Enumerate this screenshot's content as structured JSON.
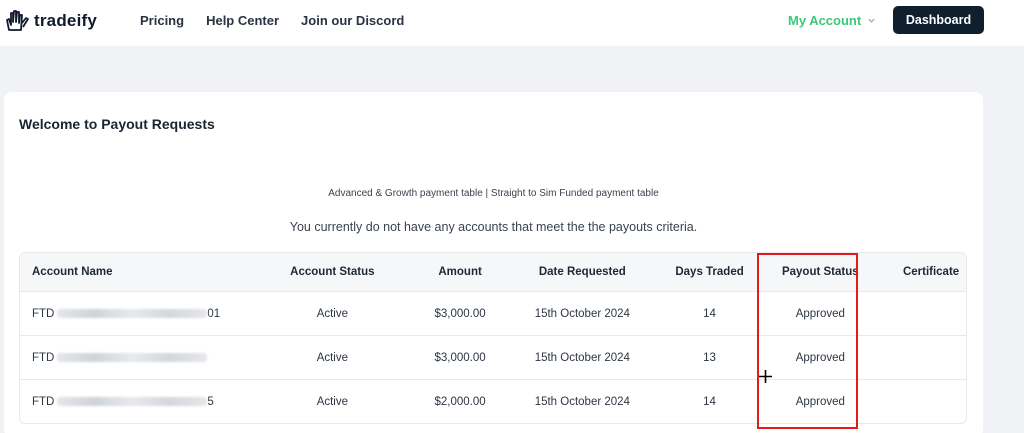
{
  "navbar": {
    "brand_name": "tradeify",
    "links": [
      "Pricing",
      "Help Center",
      "Join our Discord"
    ],
    "account_label": "My Account",
    "dashboard_label": "Dashboard"
  },
  "page": {
    "title": "Welcome to Payout Requests",
    "links_line": "Advanced & Growth payment table | Straight to Sim Funded payment table",
    "notice": "You currently do not have any accounts that meet the the payouts criteria."
  },
  "table": {
    "headers": [
      "Account Name",
      "Account Status",
      "Amount",
      "Date Requested",
      "Days Traded",
      "Payout Status",
      "Certificate"
    ],
    "rows": [
      {
        "account_prefix": "FTD",
        "account_suffix": "01",
        "status": "Active",
        "amount": "$3,000.00",
        "date": "15th October 2024",
        "days": "14",
        "payout_status": "Approved",
        "certificate": ""
      },
      {
        "account_prefix": "FTD",
        "account_suffix": "",
        "status": "Active",
        "amount": "$3,000.00",
        "date": "15th October 2024",
        "days": "13",
        "payout_status": "Approved",
        "certificate": ""
      },
      {
        "account_prefix": "FTD",
        "account_suffix": "5",
        "status": "Active",
        "amount": "$2,000.00",
        "date": "15th October 2024",
        "days": "14",
        "payout_status": "Approved",
        "certificate": ""
      }
    ]
  },
  "colors": {
    "accent_green": "#3ec77a",
    "dashboard_bg": "#0f1f2e",
    "highlight_red": "#e31b1b"
  },
  "icons": {
    "brand": "hand-logo-icon",
    "chevron": "chevron-down-icon",
    "cursor": "crosshair-cursor-icon"
  }
}
